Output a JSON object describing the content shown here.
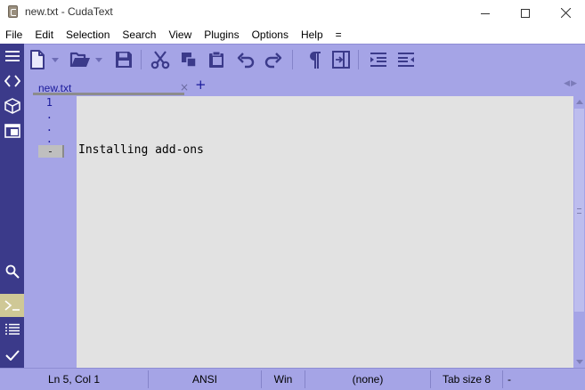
{
  "window": {
    "title": "new.txt - CudaText"
  },
  "menu": {
    "items": [
      "File",
      "Edit",
      "Selection",
      "Search",
      "View",
      "Plugins",
      "Options",
      "Help",
      "="
    ]
  },
  "toolbar": {
    "buttons": [
      "new-file",
      "new-file-dropdown",
      "open-file",
      "open-file-dropdown",
      "save",
      "cut",
      "copy",
      "paste",
      "undo",
      "redo",
      "show-unprinted",
      "wrap",
      "indent",
      "unindent"
    ]
  },
  "sidebar": {
    "buttons": [
      "menu",
      "code-tree",
      "project",
      "tabs",
      "search",
      "console",
      "output",
      "validate"
    ],
    "active": "console"
  },
  "tabs": {
    "items": [
      {
        "label": "new.txt",
        "close": "×"
      }
    ],
    "add": "+",
    "arrows": "◀▶"
  },
  "editor": {
    "gutter": [
      "1",
      ".",
      ".",
      ".",
      "-"
    ],
    "lines": [
      "",
      "",
      "",
      "",
      "Installing add-ons"
    ]
  },
  "status": {
    "position": "Ln 5, Col 1",
    "encoding": "ANSI",
    "line_ends": "Win",
    "lexer": "(none)",
    "tab_size": "Tab size 8",
    "extra": "-"
  },
  "colors": {
    "theme_bg": "#a5a4e6",
    "sidebar_bg": "#3b3a8a",
    "editor_bg": "#e2e2e2",
    "accent_text": "#1a1a9a",
    "active_sidebar": "#cfc896"
  }
}
